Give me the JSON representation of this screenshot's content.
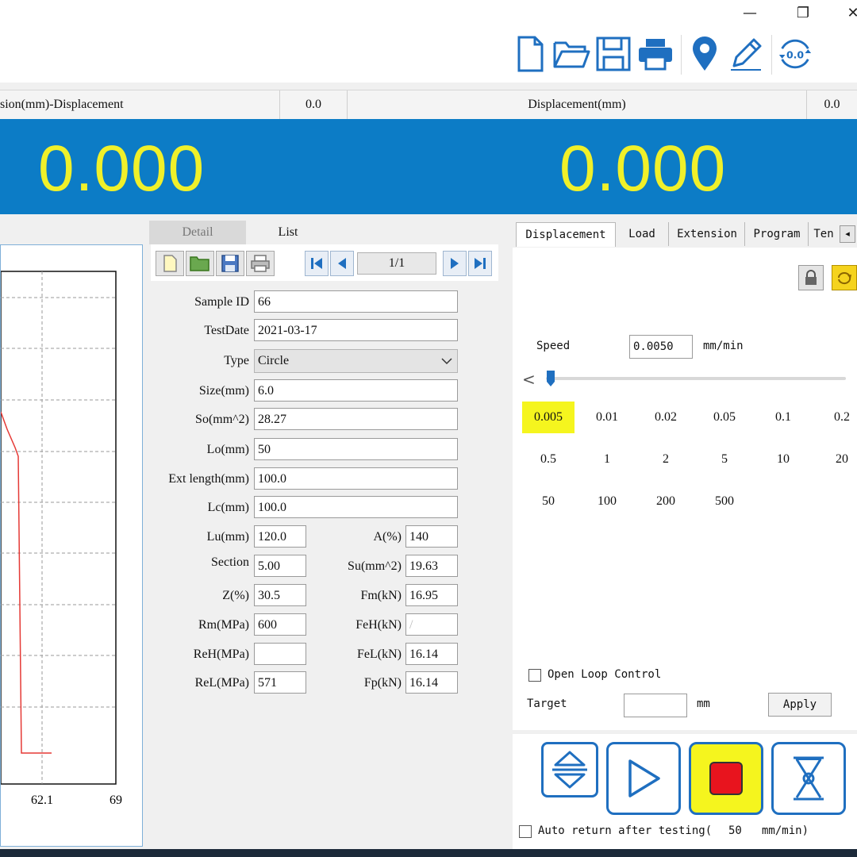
{
  "window": {
    "minimize_glyph": "—",
    "restore_glyph": "❐",
    "close_glyph": "✕"
  },
  "toolbar": {
    "icons": [
      "new-file-icon",
      "open-folder-icon",
      "save-icon",
      "print-icon",
      "location-pin-icon",
      "edit-pencil-icon",
      "zero-reset-icon"
    ],
    "zero_label": "0.0",
    "accent": "#1f6fc0"
  },
  "header": {
    "left_title": "sion(mm)-Displacement",
    "left_value": "0.0",
    "right_title": "Displacement(mm)",
    "right_value": "0.0"
  },
  "display": {
    "left_value": "0.000",
    "right_value": "0.000",
    "bg": "#0c7cc6",
    "fg": "#f0f02a"
  },
  "chart": {
    "x_ticks": [
      "62.1",
      "69"
    ],
    "line_color": "#e53935"
  },
  "detail": {
    "tabs": [
      "Detail",
      "List"
    ],
    "page": "1/1",
    "fields": {
      "sample_id": {
        "label": "Sample ID",
        "value": "66"
      },
      "test_date": {
        "label": "TestDate",
        "value": "2021-03-17"
      },
      "type": {
        "label": "Type",
        "value": "Circle"
      },
      "size": {
        "label": "Size(mm)",
        "value": "6.0"
      },
      "so": {
        "label": "So(mm^2)",
        "value": "28.27"
      },
      "lo": {
        "label": "Lo(mm)",
        "value": "50"
      },
      "ext_length": {
        "label": "Ext length(mm)",
        "value": "100.0"
      },
      "lc": {
        "label": "Lc(mm)",
        "value": "100.0"
      },
      "lu": {
        "label": "Lu(mm)",
        "value": "120.0"
      },
      "section": {
        "label": "Section",
        "value": "5.00"
      },
      "z": {
        "label": "Z(%)",
        "value": "30.5"
      },
      "rm": {
        "label": "Rm(MPa)",
        "value": "600"
      },
      "reh": {
        "label": "ReH(MPa)",
        "value": ""
      },
      "rel": {
        "label": "ReL(MPa)",
        "value": "571"
      },
      "a": {
        "label": "A(%)",
        "value": "140"
      },
      "su": {
        "label": "Su(mm^2)",
        "value": "19.63"
      },
      "fm": {
        "label": "Fm(kN)",
        "value": "16.95"
      },
      "feh": {
        "label": "FeH(kN)",
        "value": "/"
      },
      "fel": {
        "label": "FeL(kN)",
        "value": "16.14"
      },
      "fp": {
        "label": "Fp(kN)",
        "value": "16.14"
      }
    }
  },
  "control": {
    "tabs": [
      "Displacement",
      "Load",
      "Extension",
      "Program",
      "Ten"
    ],
    "speed_label": "Speed",
    "speed_value": "0.0050",
    "speed_unit": "mm/min",
    "slider_arrow": "<",
    "speeds": [
      "0.005",
      "0.01",
      "0.02",
      "0.05",
      "0.1",
      "0.2",
      "0.5",
      "1",
      "2",
      "5",
      "10",
      "20",
      "50",
      "100",
      "200",
      "500"
    ],
    "selected_speed": "0.005",
    "highlight": "#f5f51e",
    "open_loop_label": "Open Loop Control",
    "target_label": "Target",
    "target_value": "",
    "target_unit": "mm",
    "apply_label": "Apply",
    "auto_return_label": "Auto return after testing(",
    "auto_return_value": "50",
    "auto_return_unit": "mm/min)",
    "buttons": [
      "up-down-icon",
      "play-icon",
      "stop-icon",
      "hourglass-icon"
    ],
    "stop_color": "#e8141e"
  }
}
